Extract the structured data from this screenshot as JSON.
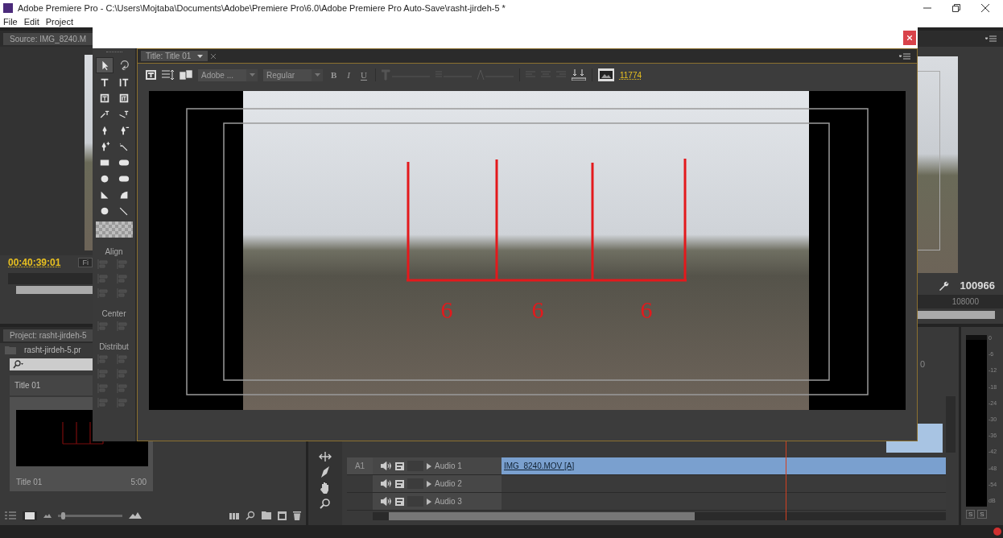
{
  "window": {
    "title": "Adobe Premiere Pro - C:\\Users\\Mojtaba\\Documents\\Adobe\\Premiere Pro\\6.0\\Adobe Premiere Pro Auto-Save\\rasht-jirdeh-5 *"
  },
  "menu": [
    "File",
    "Edit",
    "Project"
  ],
  "source_monitor": {
    "tab": "Source: IMG_8240.M",
    "timecode": "00:40:39:01",
    "button": "Fi"
  },
  "program_monitor": {
    "timecode": "100966",
    "ruler_label": "108000"
  },
  "project_panel": {
    "tab": "Project: rasht-jirdeh-5",
    "project_file": "rasht-jirdeh-5.pr",
    "column_header": "Title 01",
    "zoom_slider": {
      "level": 0.05
    },
    "items": [
      {
        "name": "Title 01",
        "duration": "5:00"
      }
    ]
  },
  "title_tools": {
    "sections": [
      "Align",
      "Center",
      "Distribut"
    ]
  },
  "title_designer": {
    "tab": "Title: Title 01",
    "font_family": "Adobe ...",
    "font_style": "Regular",
    "format_buttons": [
      "B",
      "I",
      "U"
    ],
    "timecode": "11774",
    "canvas_labels": [
      "6",
      "6",
      "6"
    ]
  },
  "timeline": {
    "ruler_fragment": "0",
    "tracks": [
      {
        "target": "A1",
        "name": "Audio 1",
        "locked": false,
        "clip": "IMG_8240.MOV [A]"
      },
      {
        "name": "Audio 2",
        "locked": false
      },
      {
        "name": "Audio 3",
        "locked": false
      }
    ]
  },
  "audio_meter": {
    "scale": [
      "0",
      "-6",
      "-12",
      "-18",
      "-24",
      "-30",
      "-36",
      "-42",
      "-48",
      "-54",
      "dB"
    ],
    "solo_buttons": [
      "S",
      "S"
    ]
  }
}
